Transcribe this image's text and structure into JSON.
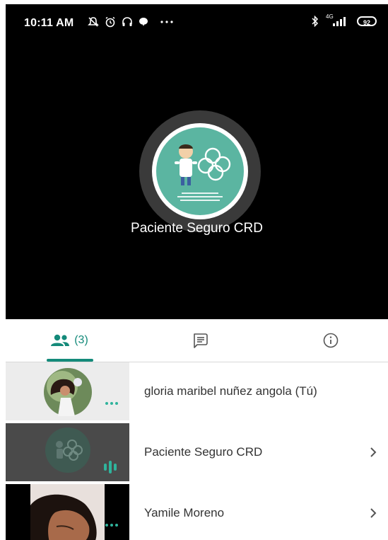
{
  "status_bar": {
    "time": "10:11 AM",
    "network": "4G",
    "battery": "92"
  },
  "stage": {
    "presenter_name": "Paciente Seguro CRD"
  },
  "tabs": [
    {
      "name": "people",
      "count": "(3)",
      "active": true
    },
    {
      "name": "chat",
      "active": false
    },
    {
      "name": "info",
      "active": false
    }
  ],
  "participants": [
    {
      "name": "gloria maribel nuñez angola (Tú)",
      "indicator": "more-dots-icon"
    },
    {
      "name": "Paciente Seguro CRD",
      "indicator": "speaking-icon"
    },
    {
      "name": "Yamile Moreno",
      "indicator": "more-dots-icon"
    }
  ],
  "colors": {
    "accent": "#148a7a",
    "stage_bg": "#000000",
    "logo_bg": "#5bb5a1"
  }
}
